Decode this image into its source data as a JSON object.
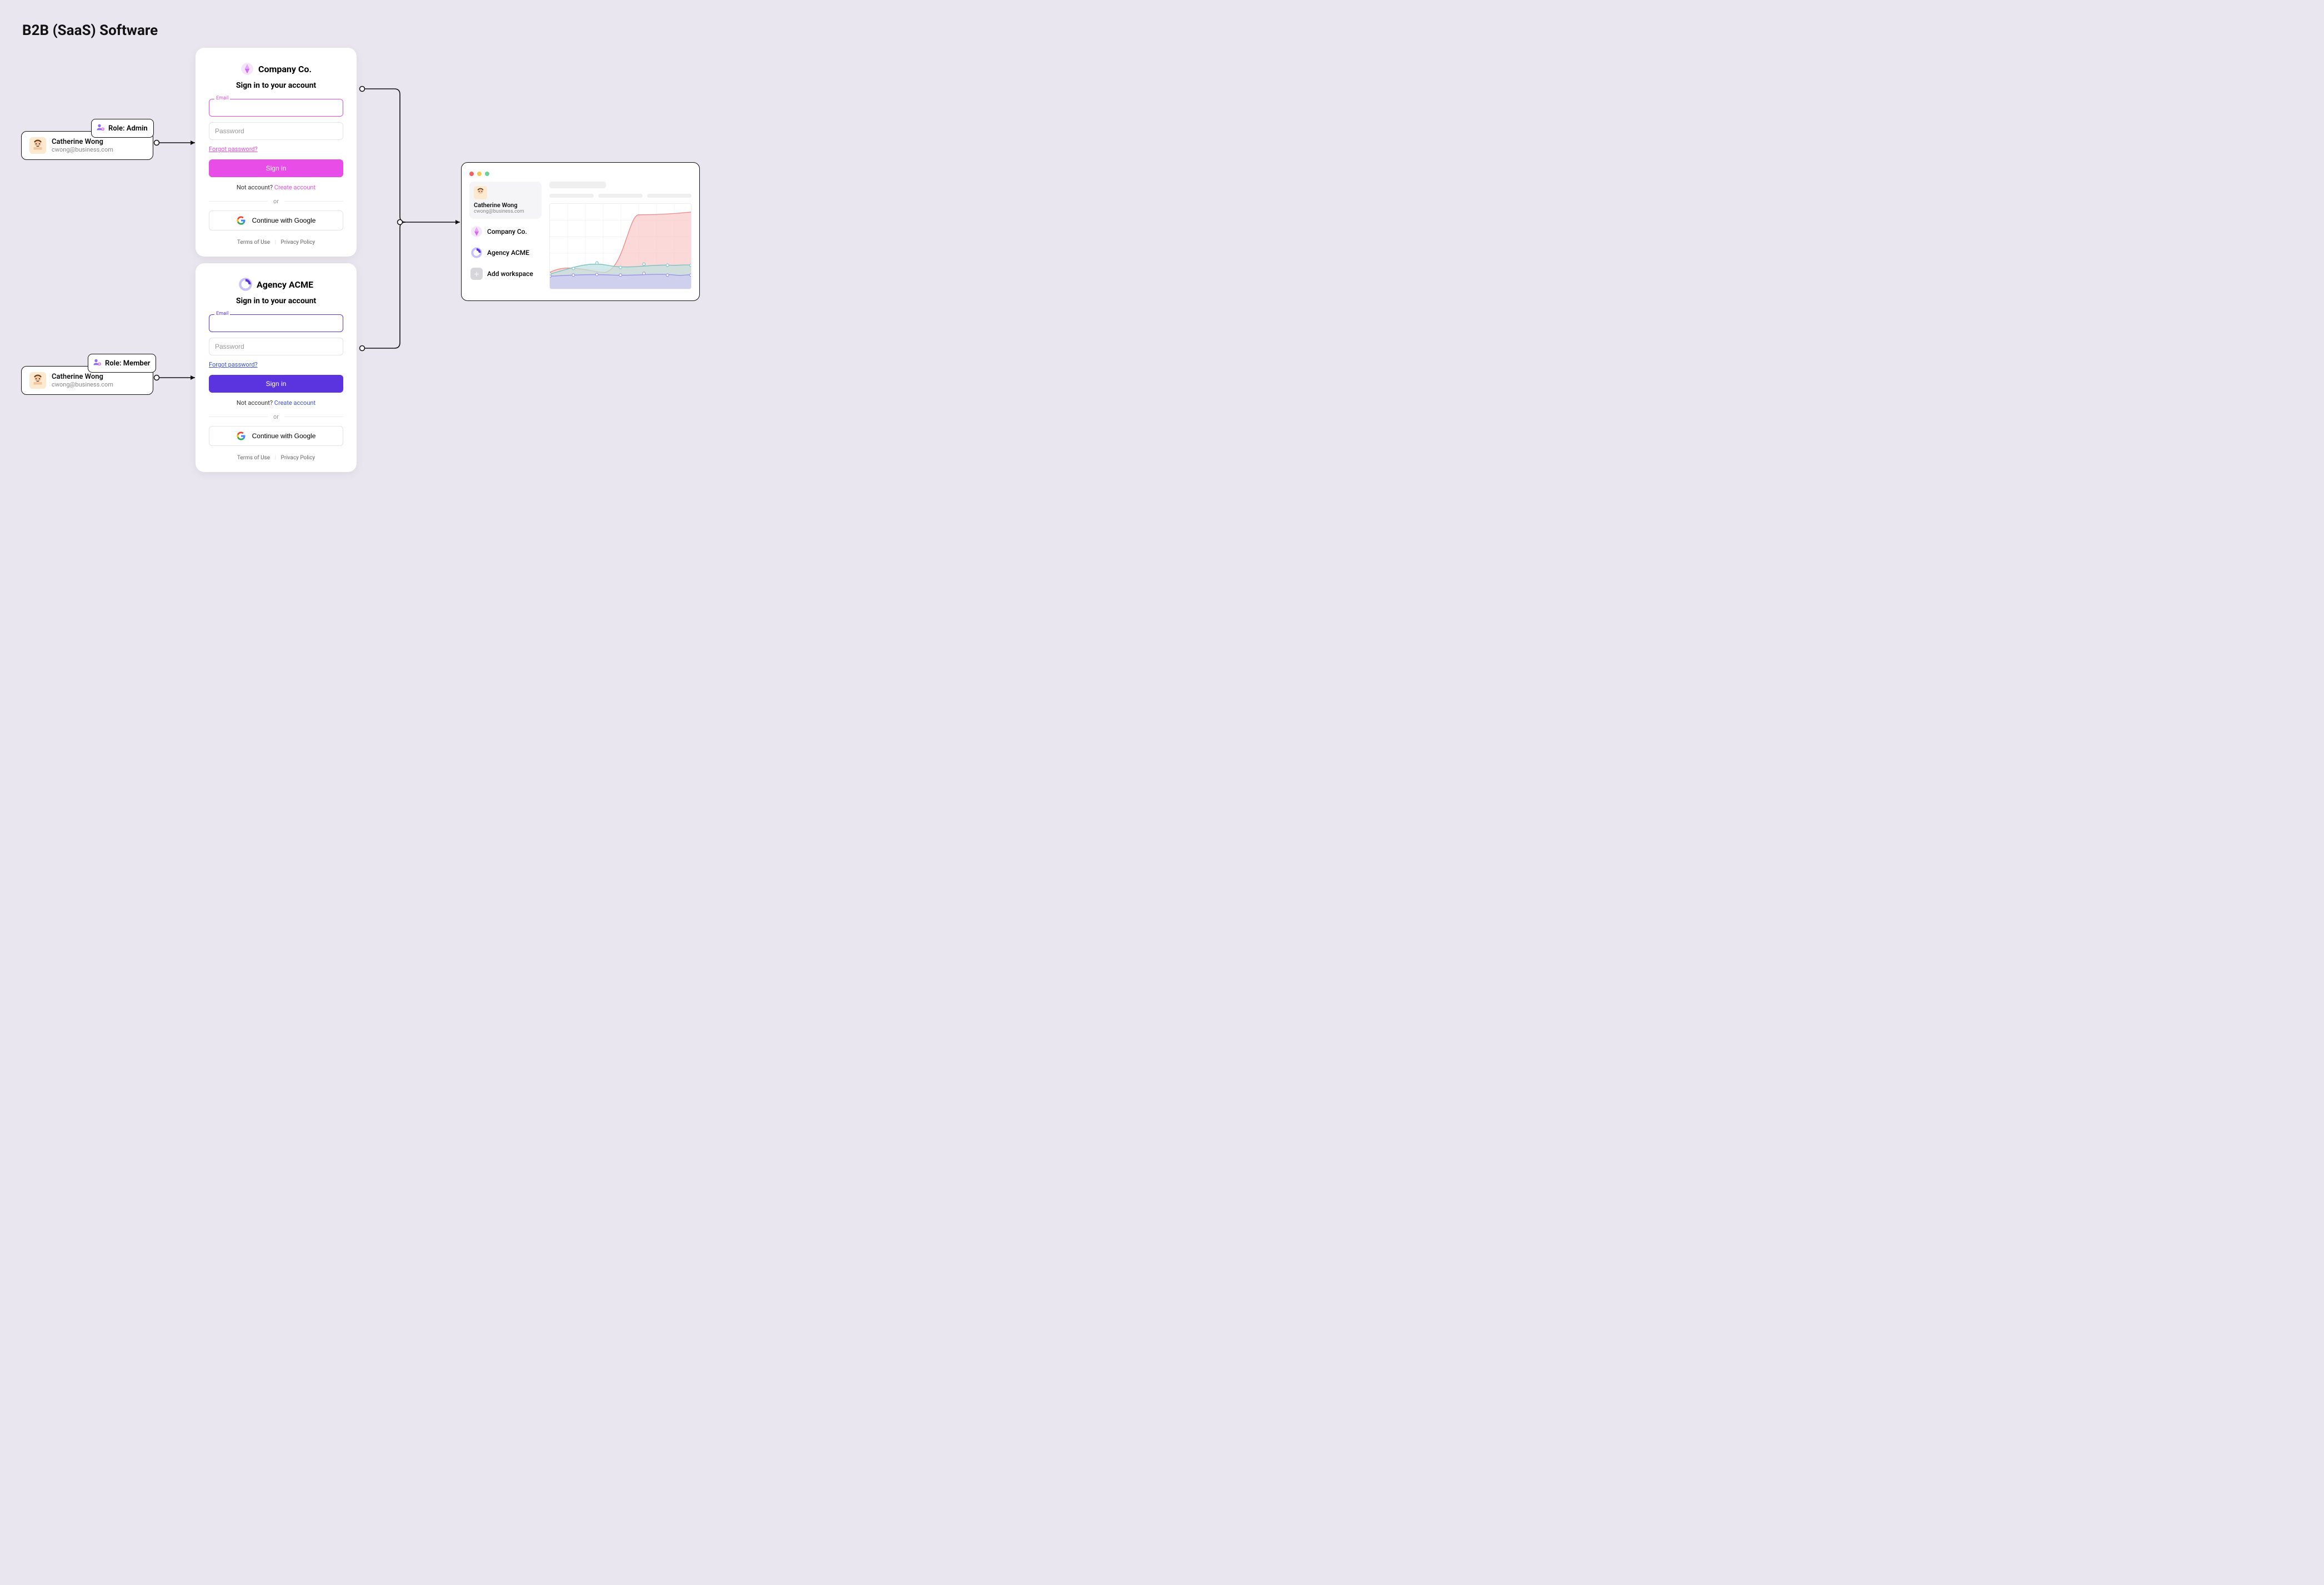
{
  "page_title": "B2B (SaaS) Software",
  "users": [
    {
      "name": "Catherine Wong",
      "email": "cwong@business.com",
      "role_label": "Role: Admin"
    },
    {
      "name": "Catherine Wong",
      "email": "cwong@business.com",
      "role_label": "Role: Member"
    }
  ],
  "login_common": {
    "subtitle": "Sign in to your account",
    "email_label": "Email",
    "password_placeholder": "Password",
    "forgot": "Forgot password?",
    "signin": "Sign in",
    "no_account_prefix": "Not account? ",
    "create_account": "Create account",
    "or": "or",
    "google": "Continue with Google",
    "terms": "Terms of Use",
    "privacy": "Privacy Policy"
  },
  "tenants": [
    {
      "brand": "Company Co.",
      "accent": "#E84DE8",
      "accent_soft": "#E84DE8",
      "label_color": "#E84DE8",
      "forgot_color": "#E84DE8",
      "create_color": "#E84DE8"
    },
    {
      "brand": "Agency ACME",
      "accent": "#5B34E0",
      "accent_soft": "#5B34E0",
      "label_color": "#5B34E0",
      "forgot_color": "#3C4FE0",
      "create_color": "#3C4FE0"
    }
  ],
  "dashboard": {
    "user": {
      "name": "Catherine Wong",
      "email": "cwong@business.com"
    },
    "workspaces": [
      {
        "label": "Company Co."
      },
      {
        "label": "Agency ACME"
      }
    ],
    "add_workspace": "Add workspace"
  }
}
